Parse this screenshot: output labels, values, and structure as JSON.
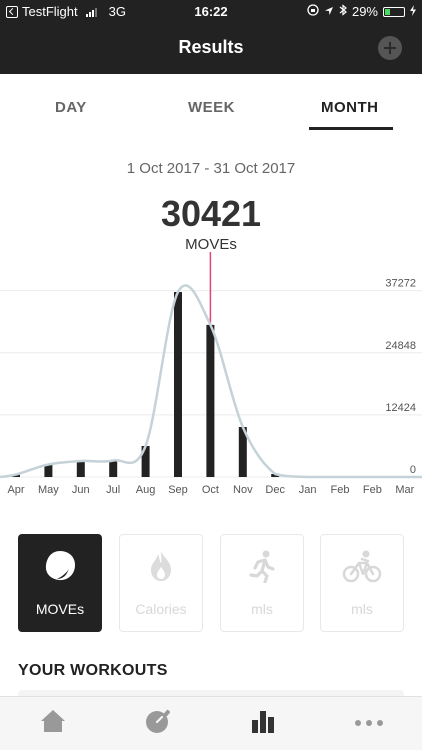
{
  "status_bar": {
    "carrier": "TestFlight",
    "network": "3G",
    "time": "16:22",
    "battery": "29%",
    "battery_level": 0.29
  },
  "navbar": {
    "title": "Results"
  },
  "tabs": [
    {
      "label": "DAY",
      "active": false
    },
    {
      "label": "WEEK",
      "active": false
    },
    {
      "label": "MONTH",
      "active": true
    }
  ],
  "summary": {
    "range": "1 Oct 2017 - 31 Oct 2017",
    "total": "30421",
    "unit": "MOVEs"
  },
  "chart_data": {
    "type": "bar",
    "categories": [
      "Apr",
      "May",
      "Jun",
      "Jul",
      "Aug",
      "Sep",
      "Oct",
      "Nov",
      "Dec",
      "Jan",
      "Feb",
      "Feb",
      "Mar"
    ],
    "values": [
      500,
      2500,
      3200,
      3300,
      6200,
      37000,
      30421,
      10000,
      600,
      0,
      0,
      0
    ],
    "ylim": [
      0,
      45000
    ],
    "yticks": [
      0,
      12424,
      24848,
      37272
    ],
    "ytick_labels": [
      "0",
      "12424",
      "24848",
      "37272"
    ],
    "selected_category": "Oct",
    "colors": {
      "bars": "#222222",
      "curve": "#c5d2d8",
      "marker": "#e0467c",
      "grid": "#ececec"
    },
    "grid": true
  },
  "metric_cards": [
    {
      "label": "MOVEs",
      "icon": "moves-blob-icon",
      "active": true
    },
    {
      "label": "Calories",
      "icon": "flame-icon",
      "active": false
    },
    {
      "label": "mls",
      "icon": "running-person-icon",
      "active": false
    },
    {
      "label": "mls",
      "icon": "cyclist-icon",
      "active": false
    }
  ],
  "workouts": {
    "title": "YOUR WORKOUTS"
  },
  "tab_bar": [
    {
      "icon": "home-icon"
    },
    {
      "icon": "stopwatch-icon"
    },
    {
      "icon": "bar-chart-icon",
      "active": true
    },
    {
      "icon": "more-icon"
    }
  ]
}
